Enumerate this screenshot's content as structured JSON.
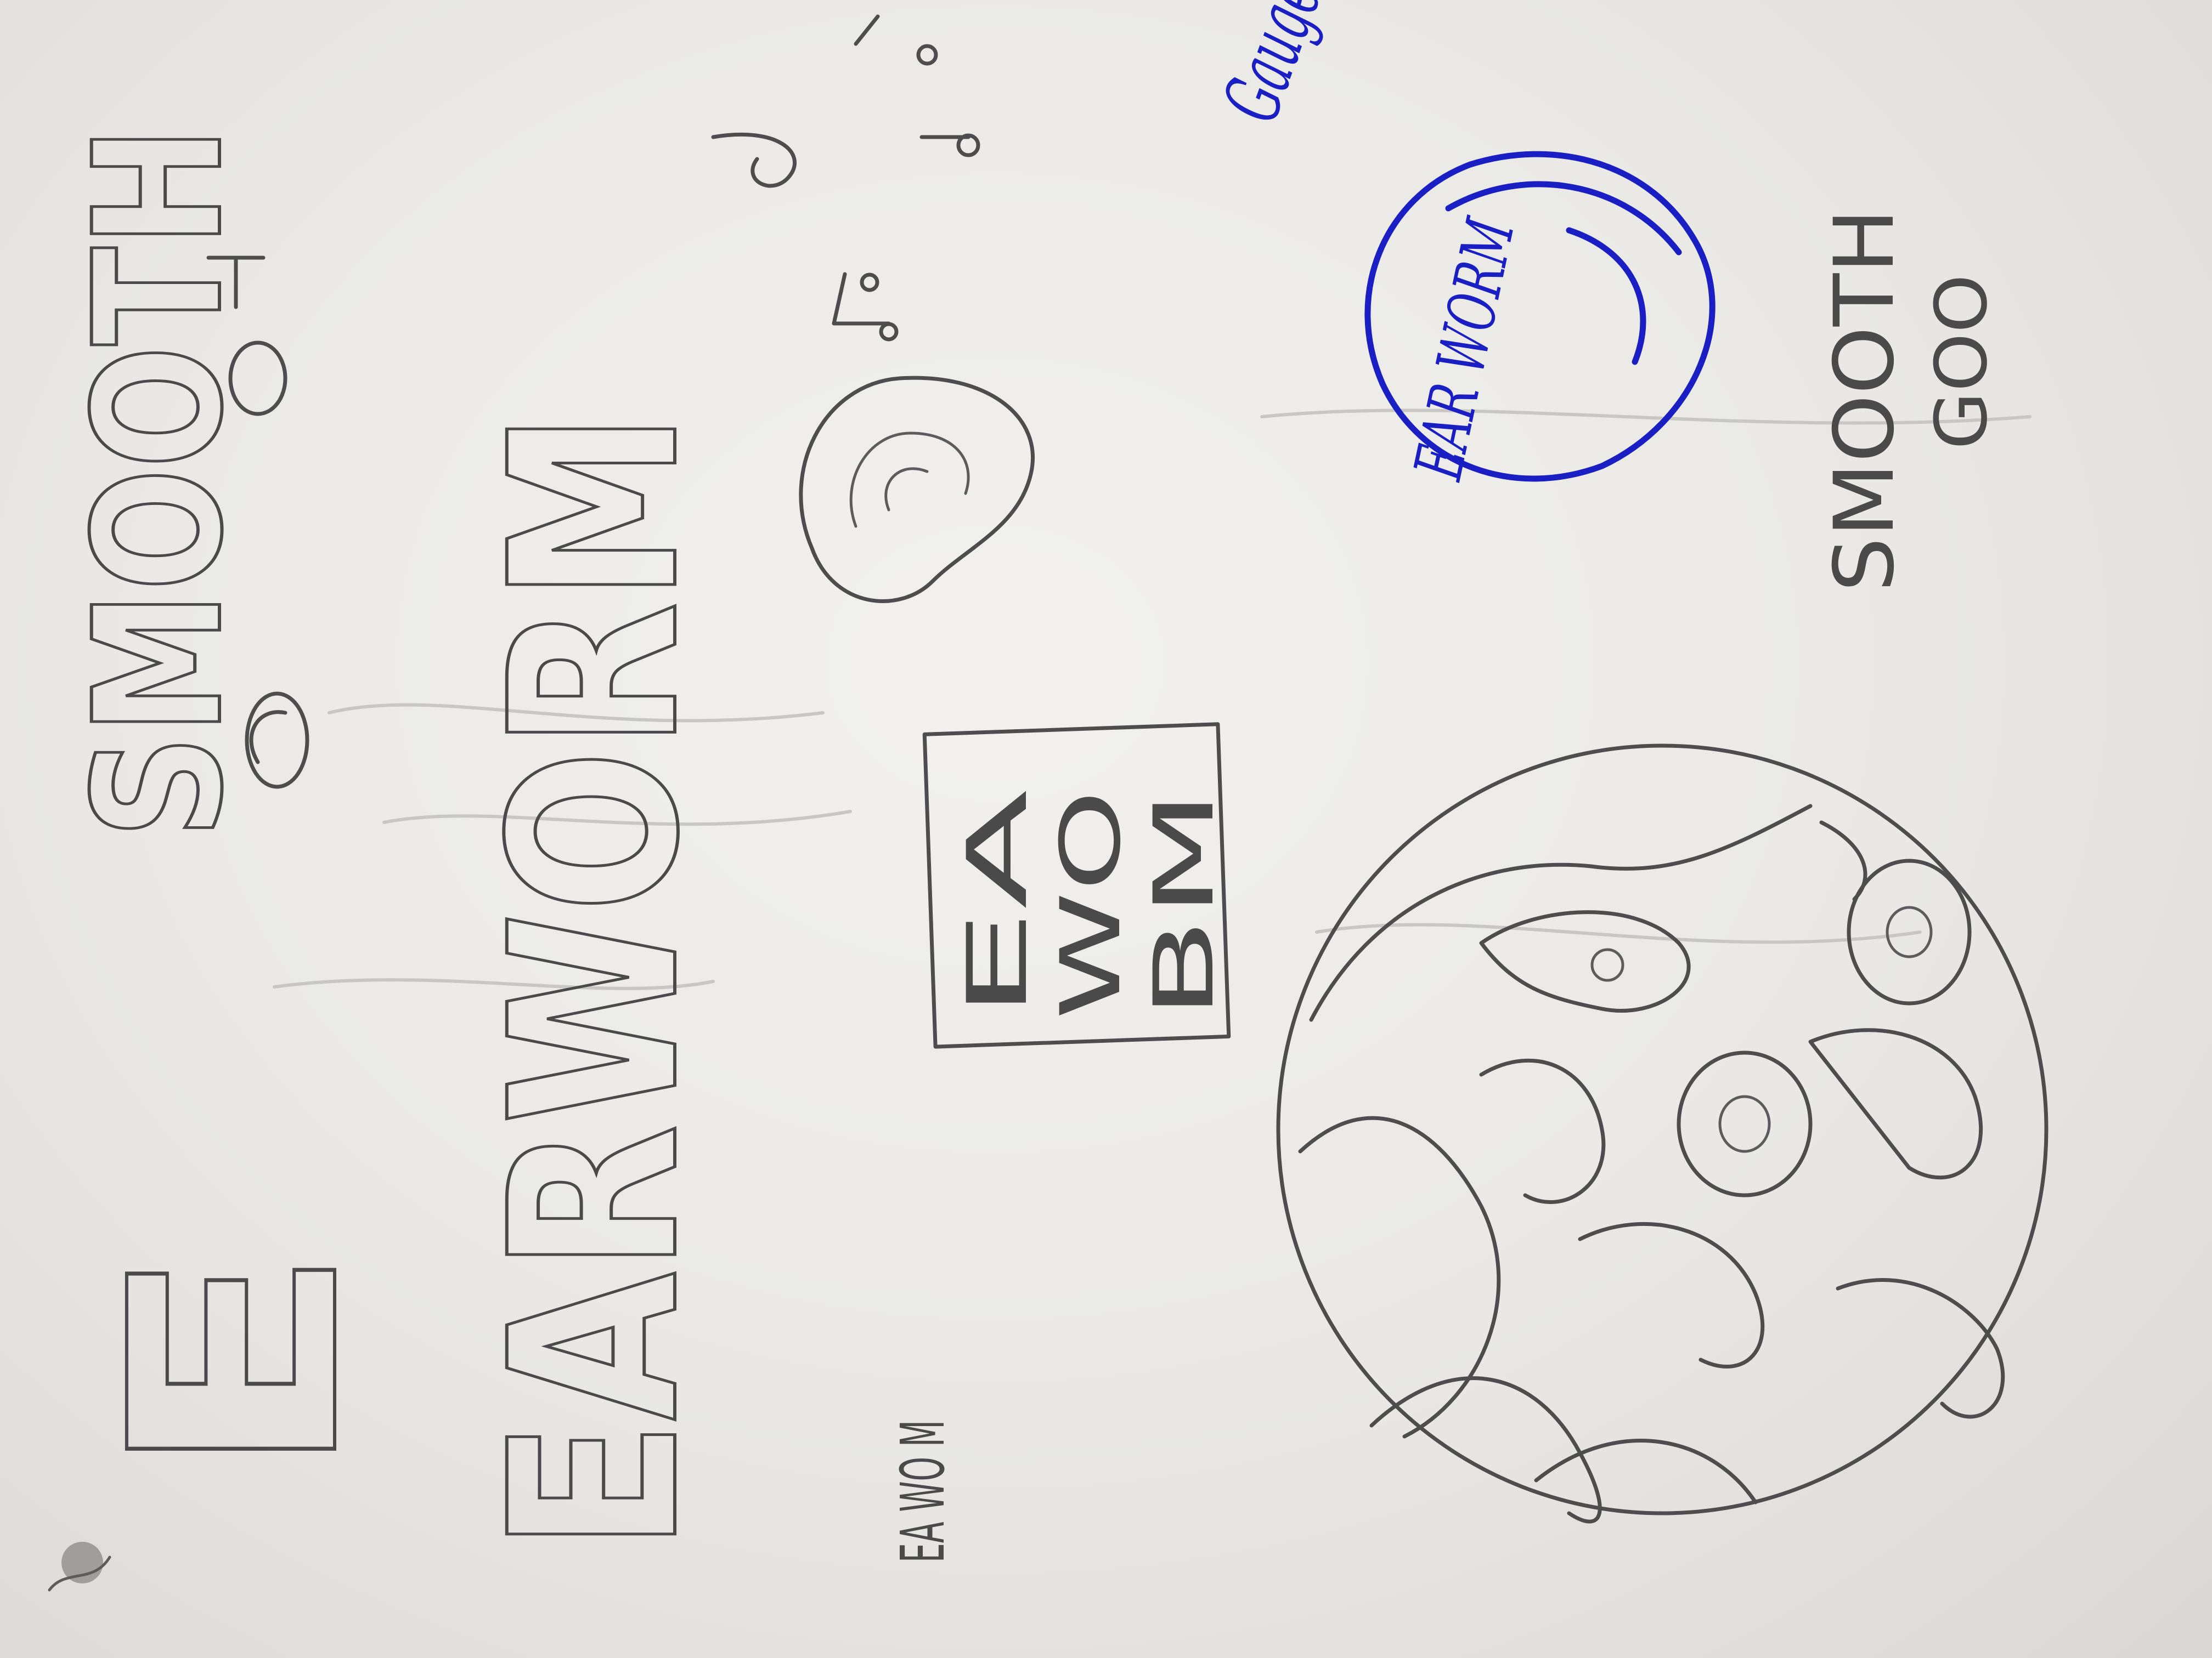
{
  "sketch": {
    "colors": {
      "paper": "#ecebe8",
      "pencil": "#4d4d4d",
      "ink": "#1a1fc4"
    },
    "lettering": {
      "smooth_vertical": "SMOOTH",
      "goo_small": "GOO",
      "block_e": "E",
      "earworm_bubble": "EARWORM",
      "box_row1": "EA",
      "box_row2": "WO",
      "box_row3": "BM",
      "small_stack": "EA WO M",
      "blue_logo": "EAR WORM",
      "blue_tag": "Gauge"
    }
  }
}
